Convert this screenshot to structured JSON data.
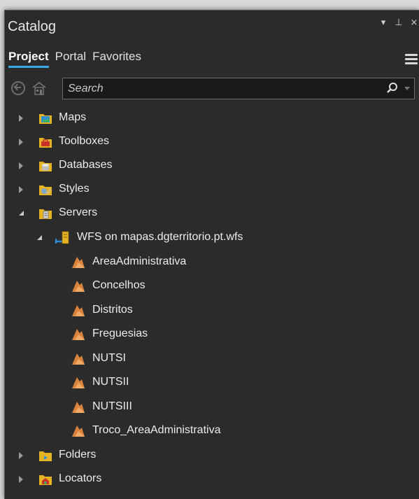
{
  "pane": {
    "title": "Catalog",
    "controls": [
      "▾",
      "⊥",
      "×"
    ]
  },
  "tabs": [
    {
      "label": "Project",
      "active": true
    },
    {
      "label": "Portal",
      "active": false
    },
    {
      "label": "Favorites",
      "active": false
    }
  ],
  "search": {
    "placeholder": "Search"
  },
  "tree": {
    "maps": "Maps",
    "toolboxes": "Toolboxes",
    "databases": "Databases",
    "styles": "Styles",
    "servers": "Servers",
    "wfs_server": "WFS on mapas.dgterritorio.pt.wfs",
    "layers": [
      "AreaAdministrativa",
      "Concelhos",
      "Distritos",
      "Freguesias",
      "NUTSI",
      "NUTSII",
      "NUTSIII",
      "Troco_AreaAdministrativa"
    ],
    "folders": "Folders",
    "locators": "Locators"
  },
  "colors": {
    "panel_bg": "#2b2b2b",
    "accent": "#3aa7e8",
    "folder": "#e6b422",
    "layer": "#d9823b"
  }
}
